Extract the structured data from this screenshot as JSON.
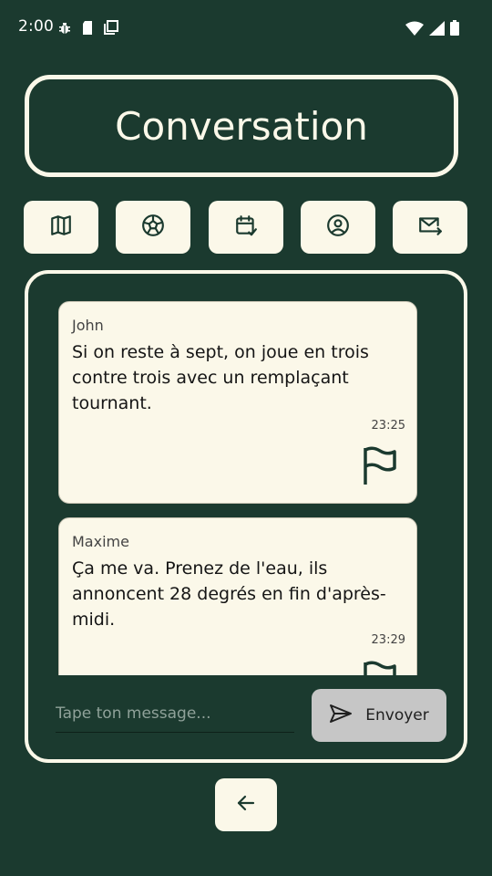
{
  "status_bar": {
    "time": "2:00",
    "left_icons": [
      "bug-icon",
      "sim-card-icon",
      "copy-icon"
    ],
    "right_icons": [
      "wifi-icon",
      "signal-icon",
      "battery-icon"
    ]
  },
  "header": {
    "title": "Conversation"
  },
  "nav": [
    {
      "icon": "map-icon"
    },
    {
      "icon": "soccer-ball-icon"
    },
    {
      "icon": "calendar-check-icon"
    },
    {
      "icon": "profile-icon"
    },
    {
      "icon": "mail-forward-icon"
    }
  ],
  "messages": [
    {
      "author": "John",
      "text": "Si on reste à sept, on joue en trois contre trois avec un remplaçant tournant.",
      "time": "23:25",
      "action_icon": "flag-icon"
    },
    {
      "author": "Maxime",
      "text": "Ça me va. Prenez de l'eau, ils annoncent 28 degrés en fin d'après-midi.",
      "time": "23:29",
      "action_icon": "flag-icon"
    }
  ],
  "composer": {
    "placeholder": "Tape ton message...",
    "value": "",
    "send_label": "Envoyer",
    "send_icon": "send-icon"
  },
  "footer": {
    "back_icon": "arrow-left-icon"
  },
  "colors": {
    "background": "#1b3a2f",
    "surface": "#fbf8e9",
    "send_button": "#c6c6c6"
  }
}
